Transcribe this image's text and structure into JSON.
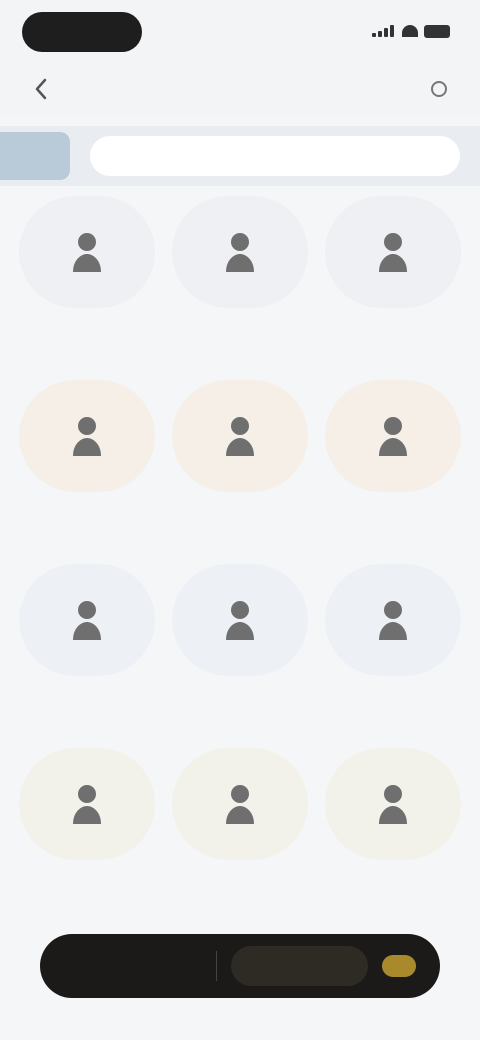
{
  "header": {
    "title": "",
    "back_icon": "chevron-left-icon",
    "more_icon": "more-icon"
  },
  "search": {
    "tag_label": "",
    "placeholder": "",
    "value": ""
  },
  "colors": {
    "accent": "#a88a2c",
    "row1_circle": "#eef0f3",
    "row2_circle": "#f5efe7",
    "row3_circle": "#edf1f6",
    "row4_circle": "#f2f2ea",
    "bottom_bar": "#1b1a18"
  },
  "grid": {
    "items": [
      {
        "label": "",
        "icon": "user-icon",
        "row": 1
      },
      {
        "label": "",
        "icon": "user-icon",
        "row": 1
      },
      {
        "label": "",
        "icon": "user-icon",
        "row": 1
      },
      {
        "label": "",
        "icon": "user-icon",
        "row": 2
      },
      {
        "label": "",
        "icon": "user-icon",
        "row": 2
      },
      {
        "label": "",
        "icon": "user-icon",
        "row": 2
      },
      {
        "label": "",
        "icon": "user-icon",
        "row": 3
      },
      {
        "label": "",
        "icon": "user-icon",
        "row": 3
      },
      {
        "label": "",
        "icon": "user-icon",
        "row": 3
      },
      {
        "label": "",
        "icon": "user-icon",
        "row": 4
      },
      {
        "label": "",
        "icon": "user-icon",
        "row": 4
      },
      {
        "label": "",
        "icon": "user-icon",
        "row": 4
      }
    ]
  },
  "bottom_bar": {
    "items": [
      {
        "label": ""
      },
      {
        "label": ""
      }
    ],
    "badge": ""
  }
}
